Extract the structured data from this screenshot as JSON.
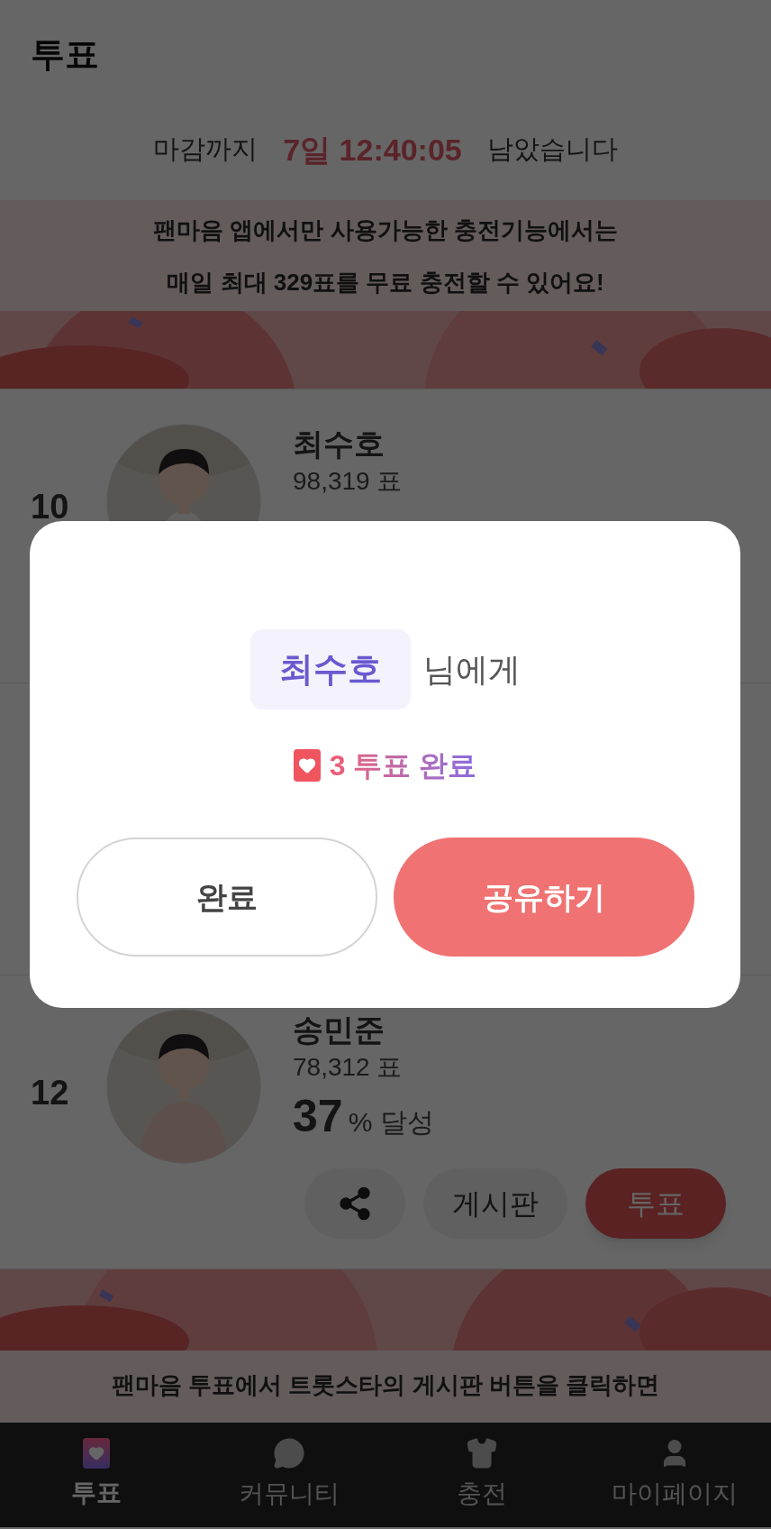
{
  "header": {
    "title": "투표"
  },
  "countdown": {
    "prefix": "마감까지",
    "time": "7일 12:40:05",
    "suffix": "남았습니다"
  },
  "top_banner": {
    "lines": [
      "팬마음 앱에서만 사용가능한 충전기능에서는",
      "매일 최대 329표를 무료 충전할 수 있어요!"
    ]
  },
  "candidates": [
    {
      "rank": "10",
      "name": "최수호",
      "votes": "98,319 표"
    },
    {
      "rank": "12",
      "name": "송민준",
      "votes": "78,312 표",
      "percent": "37",
      "percent_label": "% 달성",
      "buttons": [
        "게시판",
        "투표"
      ]
    }
  ],
  "bottom_banner": {
    "lines": [
      "팬마음 투표에서 트롯스타의 게시판 버튼을 클릭하면"
    ]
  },
  "dialog": {
    "name": "최수호",
    "suffix": "님에게",
    "result": "3 투표 완료",
    "buttons": [
      {
        "label": "완료",
        "kind": "secondary"
      },
      {
        "label": "공유하기",
        "kind": "primary"
      }
    ]
  },
  "tab_bar": [
    {
      "label": "투표",
      "selected": true
    },
    {
      "label": "커뮤니티",
      "selected": false
    },
    {
      "label": "충전",
      "selected": false
    },
    {
      "label": "마이페이지",
      "selected": false
    }
  ]
}
